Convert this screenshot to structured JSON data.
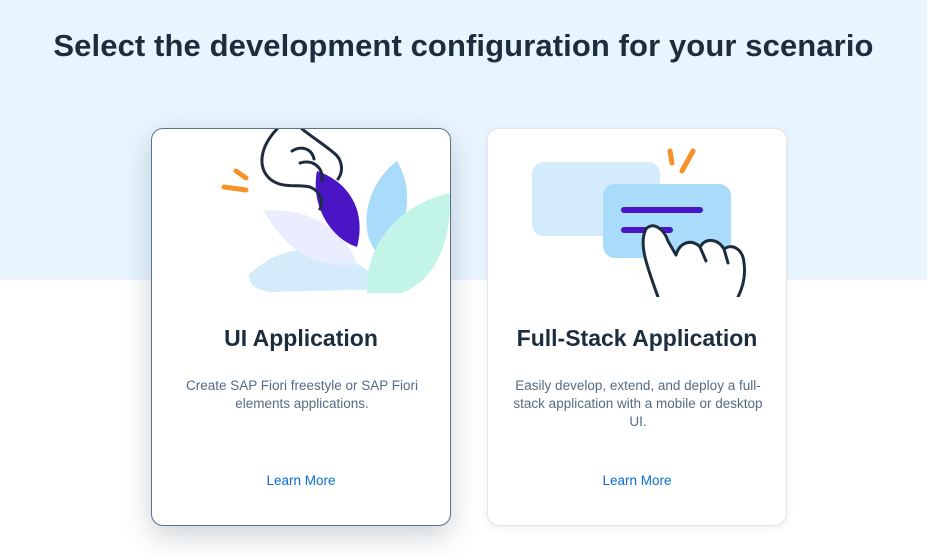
{
  "header": {
    "title": "Select the development configuration for your scenario"
  },
  "cards": [
    {
      "title": "UI Application",
      "description": "Create SAP Fiori freestyle or SAP Fiori elements applications.",
      "link": "Learn More",
      "selected": true,
      "illustration": "hand-picking-flower-illustration"
    },
    {
      "title": "Full-Stack Application",
      "description": "Easily develop, extend, and deploy a full-stack application with a mobile or desktop UI.",
      "link": "Learn More",
      "selected": false,
      "illustration": "hand-tapping-chat-bubble-illustration"
    }
  ],
  "colors": {
    "band": "#e8f5fe",
    "title": "#1d2d3e",
    "text": "#556b82",
    "link": "#0a6ed1",
    "accent_orange": "#f5922b",
    "accent_purple": "#4a16c5"
  }
}
